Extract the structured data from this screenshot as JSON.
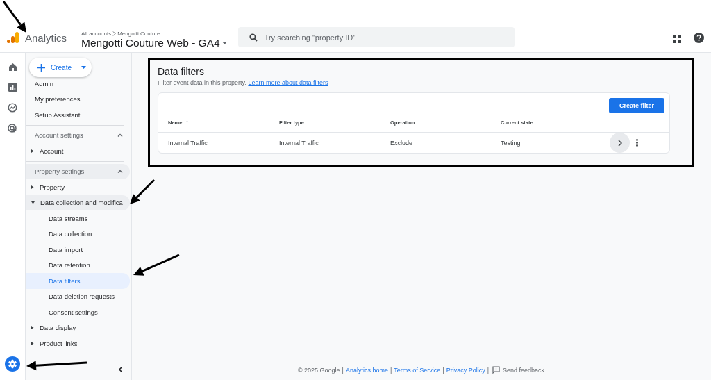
{
  "header": {
    "product": "Analytics",
    "breadcrumb": [
      "All accounts",
      "Mengotti Couture"
    ],
    "property": "Mengotti Couture Web - GA4",
    "search_placeholder": "Try searching \"property ID\""
  },
  "sidebar": {
    "create": "Create",
    "links": [
      "Admin",
      "My preferences",
      "Setup Assistant"
    ],
    "sections": [
      {
        "title": "Account settings",
        "expanded": true,
        "selected": false,
        "groups": [
          {
            "label": "Account",
            "expanded": false,
            "selected": false
          }
        ]
      },
      {
        "title": "Property settings",
        "expanded": true,
        "selected": true,
        "groups": [
          {
            "label": "Property",
            "expanded": false,
            "selected": false
          },
          {
            "label": "Data collection and modifica…",
            "expanded": true,
            "selected": true,
            "children": [
              {
                "label": "Data streams",
                "selected": false
              },
              {
                "label": "Data collection",
                "selected": false
              },
              {
                "label": "Data import",
                "selected": false
              },
              {
                "label": "Data retention",
                "selected": false
              },
              {
                "label": "Data filters",
                "selected": true
              },
              {
                "label": "Data deletion requests",
                "selected": false
              },
              {
                "label": "Consent settings",
                "selected": false
              }
            ]
          },
          {
            "label": "Data display",
            "expanded": false,
            "selected": false
          },
          {
            "label": "Product links",
            "expanded": false,
            "selected": false
          }
        ]
      }
    ]
  },
  "page": {
    "title": "Data filters",
    "description": "Filter event data in this property.",
    "link": "Learn more about data filters",
    "highlighted": true,
    "create_button": "Create filter",
    "columns": [
      "Name",
      "Filter type",
      "Operation",
      "Current state"
    ],
    "rows": [
      {
        "cells": [
          "Internal Traffic",
          "Internal Traffic",
          "Exclude",
          "Testing"
        ]
      }
    ]
  },
  "footer": [
    {
      "kind": "text",
      "text": "© 2025 Google"
    },
    {
      "kind": "separator",
      "text": "|"
    },
    {
      "kind": "link",
      "text": "Analytics home"
    },
    {
      "kind": "separator",
      "text": "|"
    },
    {
      "kind": "link",
      "text": "Terms of Service"
    },
    {
      "kind": "separator",
      "text": "|"
    },
    {
      "kind": "link",
      "text": "Privacy Policy"
    },
    {
      "kind": "separator",
      "text": "|"
    },
    {
      "kind": "feedback",
      "text": "Send feedback"
    }
  ]
}
